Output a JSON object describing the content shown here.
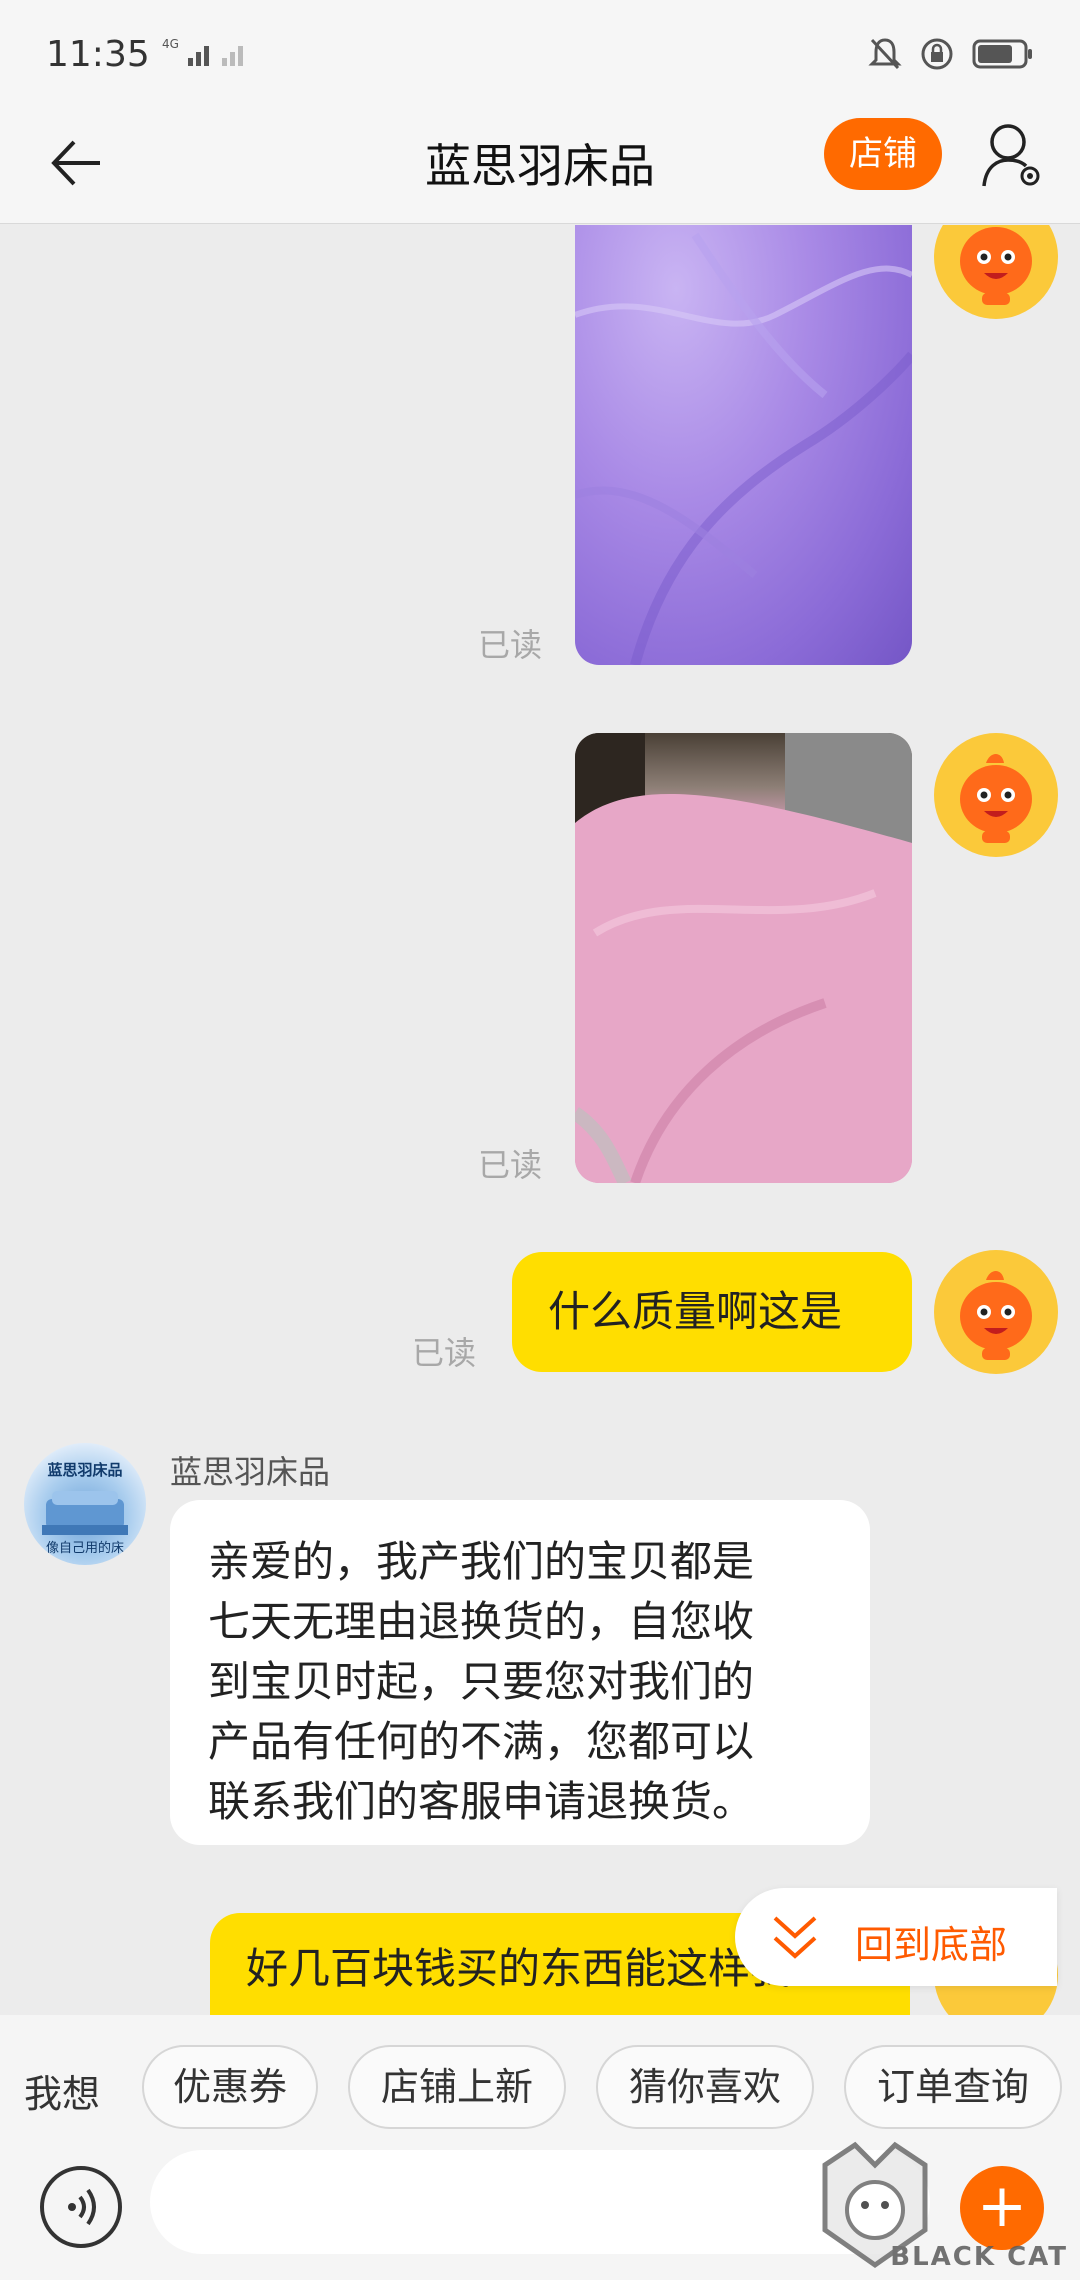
{
  "status_bar": {
    "time": "11:35",
    "network": "4G",
    "icons": [
      "bell-mute-icon",
      "lock-rotate-icon",
      "battery-icon"
    ]
  },
  "header": {
    "title": "蓝思羽床品",
    "shop_button": "店铺",
    "back_icon": "back-arrow-icon",
    "user_icon": "user-settings-icon"
  },
  "messages": {
    "read_label_1": "已读",
    "read_label_2": "已读",
    "read_label_3": "已读",
    "sent_text": "什么质量啊这是",
    "shop_name": "蓝思羽床品",
    "shop_avatar_text_top": "蓝思羽床品",
    "shop_avatar_text_bottom": "像自己用的床",
    "shop_reply_lines": [
      "亲爱的，我产我们的宝贝都是",
      "七天无理由退换货的，自您收",
      "到宝贝时起，只要您对我们的",
      "产品有任何的不满，您都可以",
      "联系我们的客服申请退换货。"
    ],
    "partial_sent_line1": "好几百块钱买的东西能这样我"
  },
  "back_to_bottom": {
    "label": "回到底部"
  },
  "quick_bar": {
    "label": "我想",
    "chips": [
      "优惠券",
      "店铺上新",
      "猜你喜欢",
      "订单查询"
    ]
  },
  "input_bar": {
    "placeholder": "",
    "plus_label": "+"
  },
  "watermark": {
    "text": "BLACK CAT"
  },
  "colors": {
    "accent": "#ff6a00",
    "bubble_self": "#ffde00",
    "background": "#ececec"
  }
}
